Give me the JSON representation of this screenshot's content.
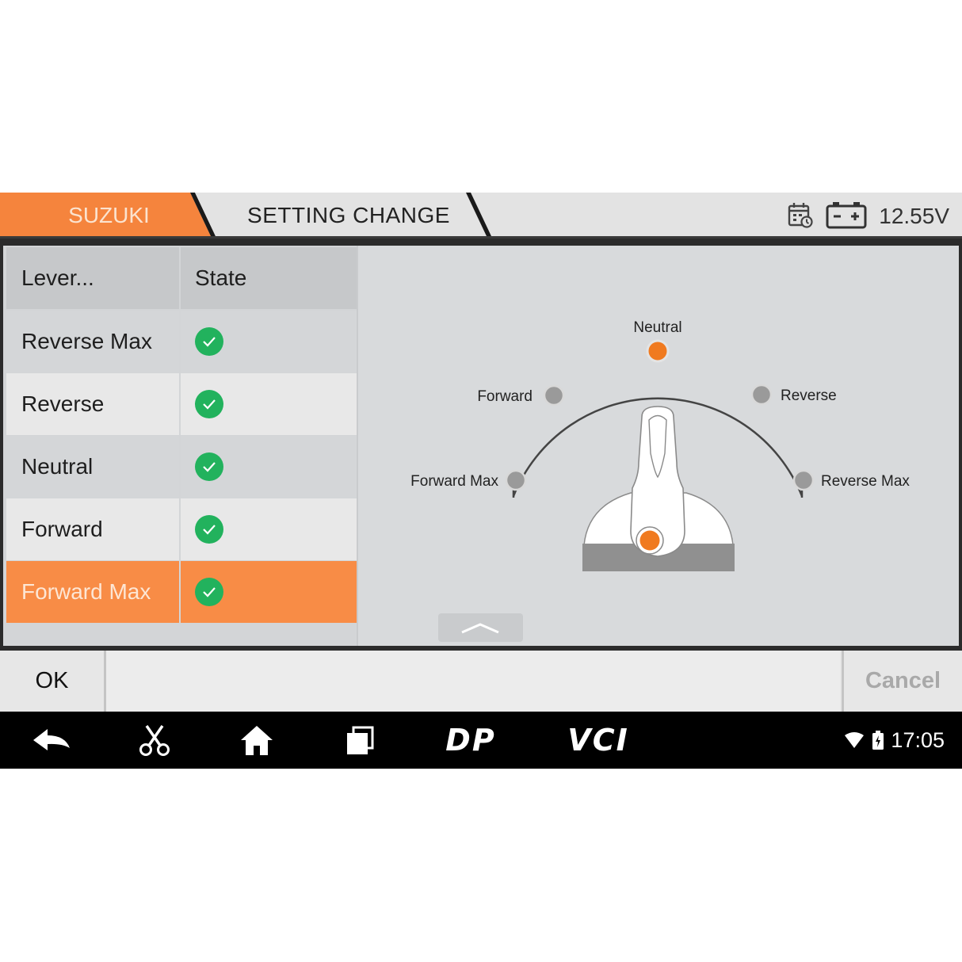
{
  "header": {
    "brand_tab": "SUZUKI",
    "title_tab": "SETTING CHANGE",
    "voltage": "12.55V",
    "icons": [
      "calendar-clock-icon",
      "battery-icon"
    ]
  },
  "table": {
    "columns": [
      "Lever...",
      "State"
    ],
    "rows": [
      {
        "label": "Reverse Max",
        "state": "check"
      },
      {
        "label": "Reverse",
        "state": "check"
      },
      {
        "label": "Neutral",
        "state": "check"
      },
      {
        "label": "Forward",
        "state": "check"
      },
      {
        "label": "Forward Max",
        "state": "check",
        "selected": true
      }
    ]
  },
  "diagram": {
    "positions": [
      "Neutral",
      "Forward",
      "Reverse",
      "Forward Max",
      "Reverse Max"
    ],
    "active_position": "Neutral"
  },
  "buttons": {
    "ok": "OK",
    "cancel": "Cancel"
  },
  "navbar": {
    "icons": [
      "back-icon",
      "scissors-icon",
      "home-icon",
      "recent-apps-icon"
    ],
    "dp": "DP",
    "vci": "VCI",
    "time": "17:05"
  },
  "colors": {
    "accent": "#f88c46",
    "check": "#22b25d",
    "active_dot": "#f07a1f",
    "inactive_dot": "#9a9a9a"
  }
}
